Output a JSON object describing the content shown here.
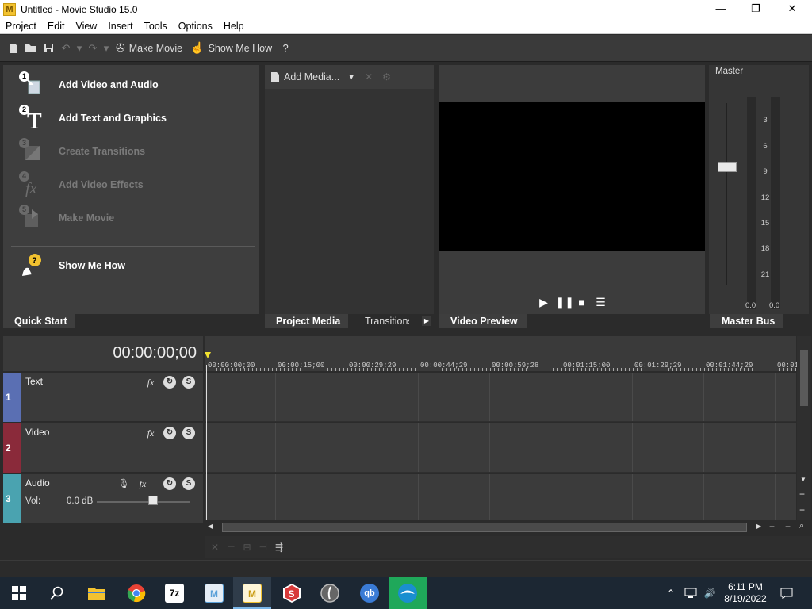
{
  "window": {
    "title": "Untitled - Movie Studio 15.0",
    "app_icon_letter": "M",
    "minimize": "—",
    "restore": "❐",
    "close": "✕"
  },
  "menubar": [
    "Project",
    "Edit",
    "View",
    "Insert",
    "Tools",
    "Options",
    "Help"
  ],
  "toolbar": {
    "make_movie": "Make Movie",
    "show_me_how": "Show Me How"
  },
  "quick_start": {
    "items": [
      {
        "num": "1",
        "label": "Add Video and Audio",
        "enabled": true
      },
      {
        "num": "2",
        "label": "Add Text and Graphics",
        "enabled": true
      },
      {
        "num": "3",
        "label": "Create Transitions",
        "enabled": false
      },
      {
        "num": "4",
        "label": "Add Video Effects",
        "enabled": false
      },
      {
        "num": "5",
        "label": "Make Movie",
        "enabled": false
      }
    ],
    "show_me_how": "Show Me How",
    "tab": "Quick Start"
  },
  "project_media": {
    "add_media": "Add Media...",
    "tabs": [
      "Project Media",
      "Transitions"
    ]
  },
  "video_preview": {
    "tab": "Video Preview"
  },
  "master": {
    "title": "Master",
    "tab": "Master Bus",
    "scale": [
      "3",
      "6",
      "9",
      "12",
      "15",
      "18",
      "21"
    ],
    "left_value": "0.0",
    "right_value": "0.0"
  },
  "timeline": {
    "timecode": "00:00:00;00",
    "ruler": [
      "00:00:00;00",
      "00:00:15;00",
      "00:00:29;29",
      "00:00:44;29",
      "00:00:59;28",
      "00:01:15;00",
      "00:01:29;29",
      "00:01:44;29",
      "00:01"
    ],
    "tracks": [
      {
        "num": "1",
        "name": "Text",
        "color": "#5a6fb3"
      },
      {
        "num": "2",
        "name": "Video",
        "color": "#8a2a3a"
      },
      {
        "num": "3",
        "name": "Audio",
        "color": "#4aa3b0",
        "vol_label": "Vol:",
        "vol_value": "0.0 dB"
      }
    ]
  },
  "taskbar": {
    "apps": [
      {
        "name": "file-explorer",
        "glyph": "",
        "color": "#f2c230"
      },
      {
        "name": "chrome",
        "glyph": "",
        "color": "#e94235"
      },
      {
        "name": "7zip",
        "glyph": "7z",
        "color": "#222"
      },
      {
        "name": "movie-maker",
        "glyph": "M",
        "color": "#5aa0d8"
      },
      {
        "name": "movie-studio",
        "glyph": "M",
        "color": "#f2c230"
      },
      {
        "name": "s-app",
        "glyph": "S",
        "color": "#d83a3a"
      },
      {
        "name": "circle-app",
        "glyph": "",
        "color": "#888"
      },
      {
        "name": "qbittorrent",
        "glyph": "qb",
        "color": "#3a7bd5"
      },
      {
        "name": "edge-like",
        "glyph": "",
        "color": "#1a8fd0"
      }
    ],
    "time": "6:11 PM",
    "date": "8/19/2022"
  }
}
